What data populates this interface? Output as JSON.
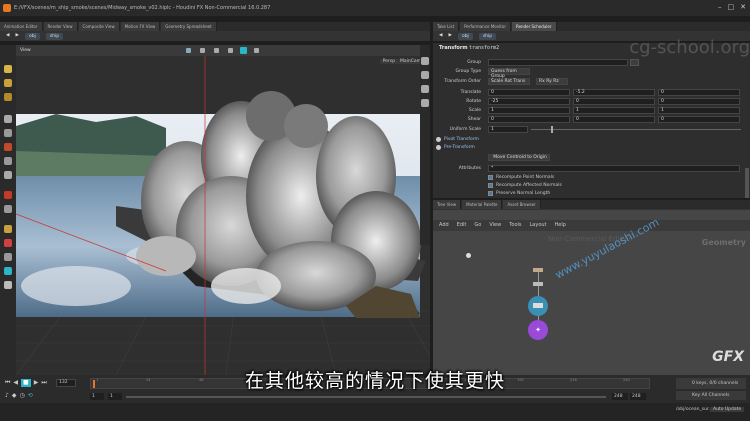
{
  "window": {
    "title": "E:/VFX/scenes/m_ship_smoke/scenes/Midway_smoke_v02.hiplc - Houdini FX Non-Commercial 16.0.287"
  },
  "viewport_tabs": [
    "Animation Editor",
    "Render View",
    "Composite View",
    "Motion FX View",
    "Geometry Spreadsheet"
  ],
  "viewport_path": [
    "obj",
    "ship"
  ],
  "viewport": {
    "label": "View",
    "persp_label": "Persp",
    "cam_label": "MainCam"
  },
  "params_tabs": [
    "Take List",
    "Performance Monitor",
    "Render Scheduler"
  ],
  "params_path": [
    "obj",
    "ship"
  ],
  "transform": {
    "node_type": "Transform",
    "node_name": "transform2",
    "rows": [
      {
        "label": "Group",
        "values": [
          ""
        ]
      },
      {
        "label": "Group Type",
        "values": [
          "Guess from Group"
        ]
      },
      {
        "label": "Transform Order",
        "values": [
          "Scale Rot Trans",
          "Rx Ry Rz"
        ]
      },
      {
        "label": "Translate",
        "values": [
          "0",
          "-5.2",
          "0"
        ]
      },
      {
        "label": "Rotate",
        "values": [
          "-25",
          "0",
          "0"
        ]
      },
      {
        "label": "Scale",
        "values": [
          "1",
          "1",
          "1"
        ]
      },
      {
        "label": "Shear",
        "values": [
          "0",
          "0",
          "0"
        ]
      },
      {
        "label": "Uniform Scale",
        "values": [
          "1"
        ]
      }
    ],
    "pivot_transform": "Pivot Transform",
    "pre_transform": "Pre-Transform",
    "move_centroid": "Move Centroid to Origin",
    "attributes_label": "Attributes",
    "attributes_value": "*",
    "checkboxes": [
      "Recompute Point Normals",
      "Recompute Affected Normals",
      "Preserve Normal Length"
    ]
  },
  "network_tabs": [
    "Tree View",
    "Material Palette",
    "Asset Browser"
  ],
  "network_path": [
    "obj",
    "ship"
  ],
  "network_menu": [
    "Add",
    "Edit",
    "Go",
    "View",
    "Tools",
    "Layout",
    "Help"
  ],
  "network": {
    "watermark": "Non-Commercial Edition",
    "context_label": "Geometry"
  },
  "timeline": {
    "current_frame": "132",
    "start_frame": "1",
    "start_frame_b": "1",
    "end_frame": "248",
    "end_frame_b": "248",
    "ticks": [
      "1",
      "24",
      "48",
      "72",
      "96",
      "120",
      "144",
      "168",
      "192",
      "216",
      "240"
    ],
    "keys_info": "0 keys, 0/0 channels",
    "key_all": "Key All Channels",
    "status_path": "/obj/ocean_sur...",
    "auto_update": "Auto Update"
  },
  "subtitle": "在其他较高的情况下使其更快",
  "watermarks": {
    "top": "cg-school.org",
    "mid": "www.yuyulaoshi.com",
    "logo": "GFX"
  }
}
